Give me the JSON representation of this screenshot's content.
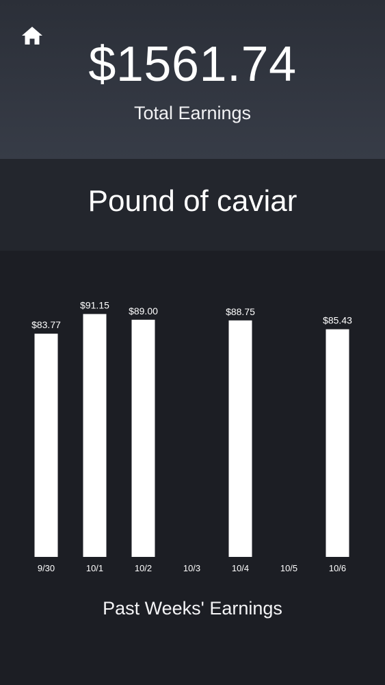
{
  "header": {
    "home_icon": "home-icon",
    "total_amount": "$1561.74",
    "total_label": "Total Earnings"
  },
  "item": {
    "title": "Pound of caviar"
  },
  "chart_data": {
    "type": "bar",
    "categories": [
      "9/30",
      "10/1",
      "10/2",
      "10/3",
      "10/4",
      "10/5",
      "10/6"
    ],
    "values": [
      83.77,
      91.15,
      89.0,
      0,
      88.75,
      0,
      85.43
    ],
    "data_labels": [
      "$83.77",
      "$91.15",
      "$89.00",
      "",
      "$88.75",
      "",
      "$85.43"
    ],
    "title": "",
    "xlabel": "Past Weeks' Earnings",
    "ylabel": "",
    "ylim": [
      0,
      100
    ],
    "grid": false,
    "bar_color": "#ffffff"
  },
  "colors": {
    "header_top": "#2b2f38",
    "header_bottom": "#373c47",
    "item_band": "#23262d",
    "background": "#1c1e24",
    "text": "#ffffff"
  }
}
